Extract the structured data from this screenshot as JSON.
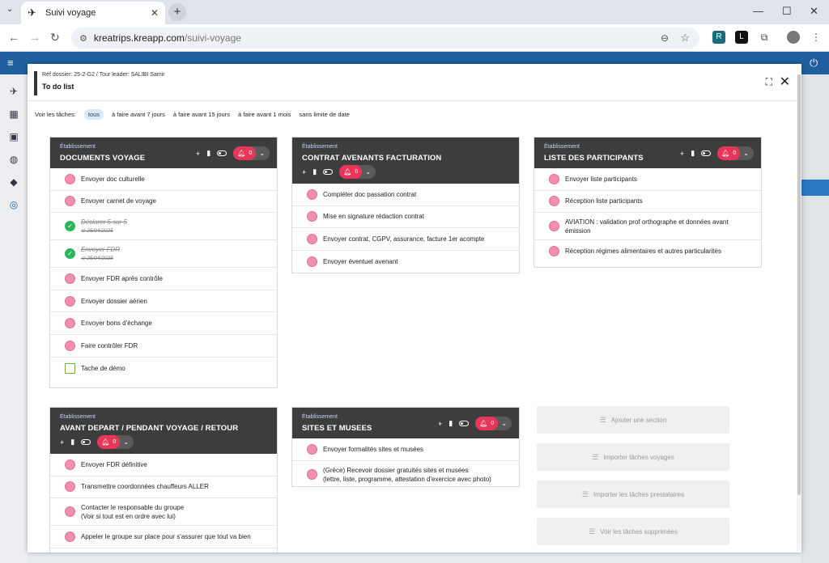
{
  "browser": {
    "tab_title": "Suivi voyage",
    "url_host": "kreatrips.kreapp.com",
    "url_path": "/suivi-voyage",
    "minimize": "—",
    "maximize": "☐",
    "close": "✕",
    "ext_labels": [
      "R",
      "L"
    ]
  },
  "modal": {
    "ref": "Réf dossier: 25-2-G2 / Tour leader: SALIBI Samir",
    "title": "To do list"
  },
  "filters": {
    "label": "Voir les tâches:",
    "options": [
      "tous",
      "à faire avant 7 jours",
      "à faire avant 15 jours",
      "à faire avant 1 mois",
      "sans limite de date"
    ],
    "active": "tous"
  },
  "cards": [
    {
      "etab": "Établissement",
      "title": "DOCUMENTS VOYAGE",
      "bell_count": "0",
      "tasks": [
        {
          "text": "Envoyer doc culturelle",
          "state": "todo"
        },
        {
          "text": "Envoyer carnet de voyage",
          "state": "todo"
        },
        {
          "text": "Déclarer 5 sur 5",
          "state": "done",
          "date": "25/04/2025"
        },
        {
          "text": "Envoyer FDR",
          "state": "done",
          "date": "25/04/2025"
        },
        {
          "text": "Envoyer FDR après contrôle",
          "state": "todo"
        },
        {
          "text": "Envoyer dossier aérien",
          "state": "todo"
        },
        {
          "text": "Envoyer bons d'échange",
          "state": "todo"
        },
        {
          "text": "Faire contrôler FDR",
          "state": "todo"
        },
        {
          "text": "Tache de démo",
          "state": "demo"
        }
      ]
    },
    {
      "etab": "Établissement",
      "title": "CONTRAT AVENANTS FACTURATION",
      "bell_count": "0",
      "tasks": [
        {
          "text": "Compléter doc passation contrat",
          "state": "todo"
        },
        {
          "text": "Mise en signature rédaction contrat",
          "state": "todo"
        },
        {
          "text": "Envoyer contrat, CGPV, assurance, facture 1er acompte",
          "state": "todo"
        },
        {
          "text": "Envoyer éventuel avenant",
          "state": "todo"
        }
      ]
    },
    {
      "etab": "Établissement",
      "title": "LISTE DES PARTICIPANTS",
      "bell_count": "0",
      "tasks": [
        {
          "text": "Envoyer liste participants",
          "state": "todo"
        },
        {
          "text": "Réception liste participants",
          "state": "todo"
        },
        {
          "text": "AVIATION : validation prof orthographe et données avant",
          "text2": "émission",
          "state": "todo"
        },
        {
          "text": "Réception régimes alimentaires et autres particularités",
          "state": "todo"
        }
      ]
    },
    {
      "etab": "Établissement",
      "title": "AVANT DEPART / PENDANT VOYAGE / RETOUR",
      "bell_count": "0",
      "tasks": [
        {
          "text": "Envoyer FDR définitive",
          "state": "todo"
        },
        {
          "text": "Transmettre coordonnées chauffeurs ALLER",
          "state": "todo"
        },
        {
          "text": "Contacter le responsable du groupe",
          "text2": "(Voir si tout est en ordre avec lui)",
          "state": "todo"
        },
        {
          "text": "Appeler le groupe sur place pour s'assurer que tout va bien",
          "state": "todo"
        }
      ]
    },
    {
      "etab": "Établissement",
      "title": "SITES ET MUSEES",
      "bell_count": "0",
      "tasks": [
        {
          "text": "Envoyer formalités sites et musées",
          "state": "todo"
        },
        {
          "text": "(Grèce) Recevoir dossier gratuités sites et musées",
          "text2": "(lettre, liste, programme, attestation d'exercice avec photo)",
          "state": "todo"
        }
      ]
    }
  ],
  "side_buttons": [
    "Ajouter une section",
    "Importer tâches voyages",
    "Importer les tâches prestataires",
    "Voir les tâches supprimées"
  ]
}
